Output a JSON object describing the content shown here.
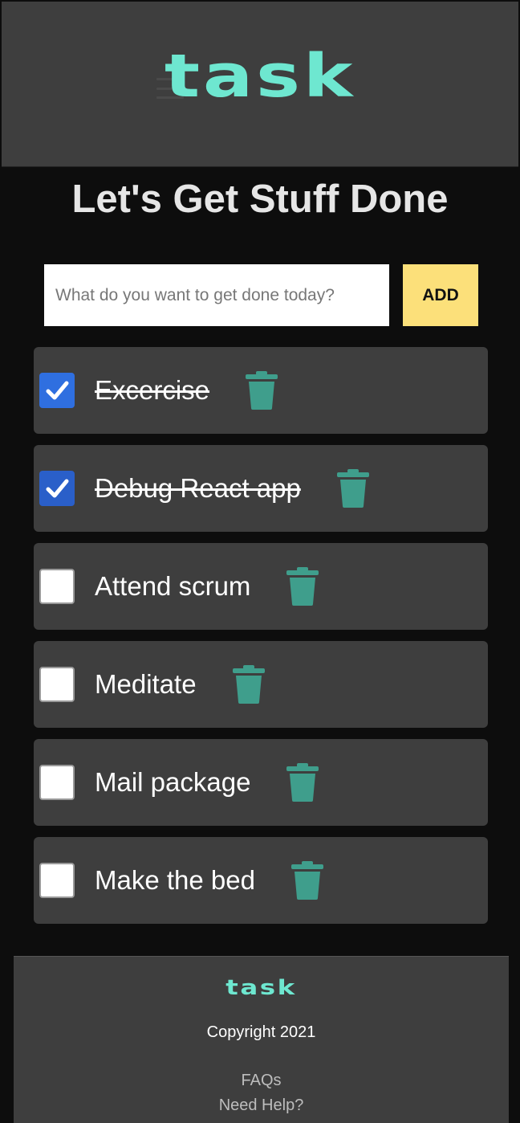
{
  "header": {
    "logo_text": "task",
    "menu_icon": "hamburger-icon"
  },
  "headline": "Let's Get Stuff Done",
  "add_form": {
    "placeholder": "What do you want to get done today?",
    "value": "",
    "add_label": "ADD"
  },
  "tasks": [
    {
      "label": "Excercise",
      "done": true
    },
    {
      "label": "Debug React app",
      "done": true
    },
    {
      "label": "Attend scrum",
      "done": false
    },
    {
      "label": "Meditate",
      "done": false
    },
    {
      "label": "Mail package",
      "done": false
    },
    {
      "label": "Make the bed",
      "done": false
    }
  ],
  "icons": {
    "check": "checkmark-icon",
    "delete": "trash-icon"
  },
  "colors": {
    "accent": "#6ee7d0",
    "trash": "#3f9e8c",
    "add_button": "#fce07a",
    "checkbox": "#2f6fe0"
  },
  "footer": {
    "logo_text": "task",
    "copyright": "Copyright 2021",
    "links": [
      "FAQs",
      "Need Help?"
    ]
  }
}
